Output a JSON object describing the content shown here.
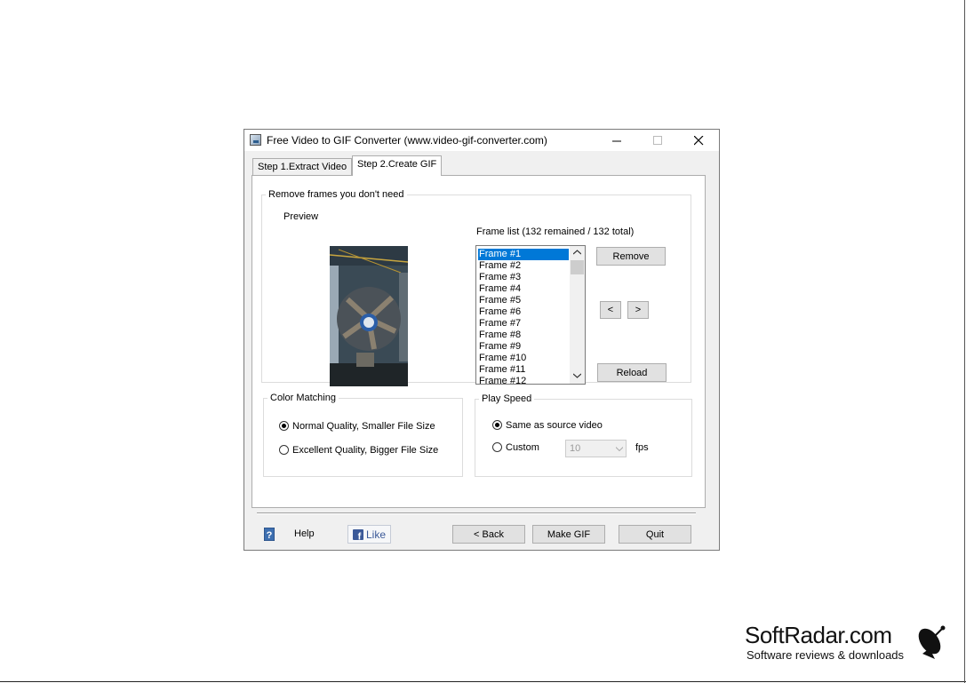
{
  "window": {
    "title": "Free Video to GIF Converter (www.video-gif-converter.com)"
  },
  "tabs": [
    {
      "label": "Step 1.Extract Video",
      "active": false
    },
    {
      "label": "Step 2.Create GIF",
      "active": true
    }
  ],
  "remove_frames": {
    "legend": "Remove frames you don't need",
    "preview_label": "Preview",
    "frame_list_label": "Frame list (132 remained / 132 total)",
    "frames": [
      "Frame #1",
      "Frame #2",
      "Frame #3",
      "Frame #4",
      "Frame #5",
      "Frame #6",
      "Frame #7",
      "Frame #8",
      "Frame #9",
      "Frame #10",
      "Frame #11",
      "Frame #12"
    ],
    "selected_frame": "Frame #1",
    "remove_label": "Remove",
    "prev_label": "<",
    "next_label": ">",
    "reload_label": "Reload"
  },
  "color_matching": {
    "legend": "Color Matching",
    "options": [
      {
        "label": "Normal Quality, Smaller File Size",
        "checked": true
      },
      {
        "label": "Excellent Quality, Bigger File Size",
        "checked": false
      }
    ]
  },
  "play_speed": {
    "legend": "Play Speed",
    "options": [
      {
        "label": "Same as source video",
        "checked": true
      },
      {
        "label": "Custom",
        "checked": false
      }
    ],
    "fps_value": "10",
    "fps_unit": "fps"
  },
  "footer": {
    "help_label": "Help",
    "like_label": "Like",
    "back_label": "< Back",
    "make_gif_label": "Make GIF",
    "quit_label": "Quit"
  },
  "watermark": {
    "brand": "SoftRadar.com",
    "tagline": "Software reviews & downloads"
  },
  "colors": {
    "selection": "#0078d7",
    "facebook": "#3b5998"
  }
}
